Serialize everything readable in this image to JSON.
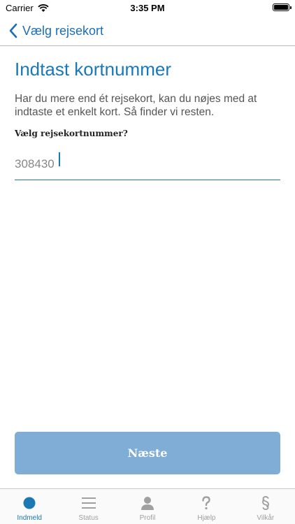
{
  "status_bar": {
    "carrier": "Carrier",
    "time": "3:35 PM"
  },
  "nav": {
    "back_label": "Vælg rejsekort"
  },
  "main": {
    "title": "Indtast kortnummer",
    "intro": "Har du mere end ét rejsekort, kan du nøjes med at indtaste et enkelt kort. Så finder vi resten.",
    "field_label": "Vælg rejsekortnummer?",
    "card_number_value": "308430",
    "next_label": "Næste"
  },
  "tabs": [
    {
      "label": "Indmeld",
      "icon": "dot-icon",
      "active": true
    },
    {
      "label": "Status",
      "icon": "list-icon",
      "active": false
    },
    {
      "label": "Profil",
      "icon": "person-icon",
      "active": false
    },
    {
      "label": "Hjælp",
      "icon": "question-icon",
      "active": false
    },
    {
      "label": "Vilkår",
      "icon": "section-icon",
      "active": false
    }
  ],
  "colors": {
    "accent": "#1a78b5",
    "button_bg": "#7fadd5",
    "inactive_tab": "#a0a0a0"
  }
}
